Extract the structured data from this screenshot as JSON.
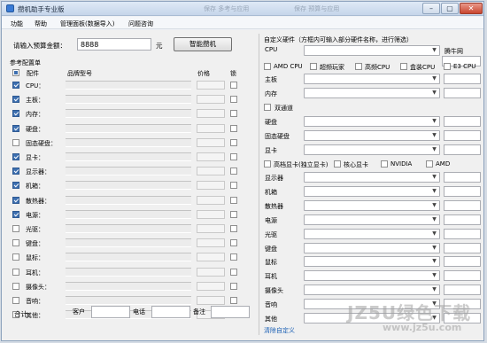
{
  "window": {
    "title": "攒机助手专业版",
    "bg_tabs": [
      "保存 多考与应用",
      "保存 预算与应用"
    ],
    "min_label": "–",
    "max_label": "▢",
    "close_label": "✕"
  },
  "menu": [
    "功能",
    "帮助",
    "管理面板(数据导入)",
    "问题咨询"
  ],
  "budget": {
    "label": "请输入预算金额：",
    "value": "8888",
    "unit": "元",
    "button": "智能攒机"
  },
  "ref": {
    "title": "参考配置单",
    "col_part": "配件",
    "col_model": "品牌型号",
    "col_price": "价格",
    "col_lock": "锁"
  },
  "parts": [
    {
      "name": "CPU：",
      "checked": true
    },
    {
      "name": "主板：",
      "checked": true
    },
    {
      "name": "内存：",
      "checked": true
    },
    {
      "name": "硬盘：",
      "checked": true
    },
    {
      "name": "固态硬盘：",
      "checked": false
    },
    {
      "name": "显卡：",
      "checked": true
    },
    {
      "name": "显示器：",
      "checked": true
    },
    {
      "name": "机箱：",
      "checked": true
    },
    {
      "name": "散热器：",
      "checked": true
    },
    {
      "name": "电源：",
      "checked": true
    },
    {
      "name": "光驱：",
      "checked": false
    },
    {
      "name": "键盘：",
      "checked": false
    },
    {
      "name": "鼠标：",
      "checked": false
    },
    {
      "name": "耳机：",
      "checked": false
    },
    {
      "name": "摄像头：",
      "checked": false
    },
    {
      "name": "音响：",
      "checked": false
    },
    {
      "name": "其他：",
      "checked": false
    }
  ],
  "footer": {
    "total": "合计:",
    "customer": "客户",
    "phone": "电话",
    "note": "备注"
  },
  "custom": {
    "title": "自定义硬件（方框内可输入部分硬件名称，进行筛选）",
    "cpu_label": "CPU",
    "cpu_side": "腾牛网",
    "cpu_filters": [
      "AMD CPU",
      "超频玩家",
      "高频CPU",
      "盒装CPU",
      "E3 CPU"
    ],
    "group1": [
      "主板",
      "内存"
    ],
    "dual_channel": "双通道",
    "group2": [
      "硬盘",
      "固态硬盘",
      "显卡"
    ],
    "gpu_filters": [
      "高档显卡(独立显卡)",
      "核心显卡",
      "NVIDIA",
      "AMD"
    ],
    "group3": [
      "显示器",
      "机箱",
      "散热器",
      "电源",
      "光驱",
      "键盘",
      "鼠标",
      "耳机",
      "摄像头",
      "音响",
      "其他"
    ],
    "clear_link": "清除自定义"
  },
  "watermark": {
    "main": "JZ5U绿色下载",
    "url": "www.jz5u.com"
  }
}
